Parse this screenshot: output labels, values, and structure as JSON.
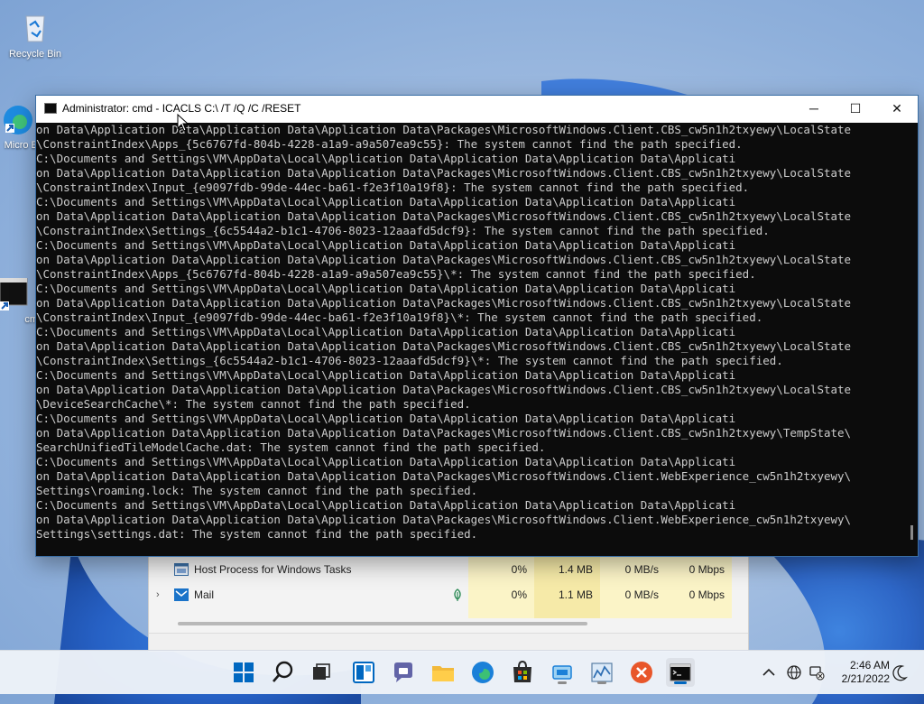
{
  "desktop": {
    "icons": [
      {
        "label": "Recycle Bin"
      },
      {
        "label": "Micro Ed"
      },
      {
        "label": "cm"
      }
    ]
  },
  "cmd_window": {
    "title": "Administrator: cmd - ICACLS  C:\\ /T /Q /C /RESET",
    "minimize_glyph": "─",
    "maximize_glyph": "☐",
    "close_glyph": "✕",
    "lines": [
      "on Data\\Application Data\\Application Data\\Application Data\\Packages\\MicrosoftWindows.Client.CBS_cw5n1h2txyewy\\LocalState",
      "\\ConstraintIndex\\Apps_{5c6767fd-804b-4228-a1a9-a9a507ea9c55}: The system cannot find the path specified.",
      "C:\\Documents and Settings\\VM\\AppData\\Local\\Application Data\\Application Data\\Application Data\\Applicati",
      "on Data\\Application Data\\Application Data\\Application Data\\Packages\\MicrosoftWindows.Client.CBS_cw5n1h2txyewy\\LocalState",
      "\\ConstraintIndex\\Input_{e9097fdb-99de-44ec-ba61-f2e3f10a19f8}: The system cannot find the path specified.",
      "C:\\Documents and Settings\\VM\\AppData\\Local\\Application Data\\Application Data\\Application Data\\Applicati",
      "on Data\\Application Data\\Application Data\\Application Data\\Packages\\MicrosoftWindows.Client.CBS_cw5n1h2txyewy\\LocalState",
      "\\ConstraintIndex\\Settings_{6c5544a2-b1c1-4706-8023-12aaafd5dcf9}: The system cannot find the path specified.",
      "C:\\Documents and Settings\\VM\\AppData\\Local\\Application Data\\Application Data\\Application Data\\Applicati",
      "on Data\\Application Data\\Application Data\\Application Data\\Packages\\MicrosoftWindows.Client.CBS_cw5n1h2txyewy\\LocalState",
      "\\ConstraintIndex\\Apps_{5c6767fd-804b-4228-a1a9-a9a507ea9c55}\\*: The system cannot find the path specified.",
      "C:\\Documents and Settings\\VM\\AppData\\Local\\Application Data\\Application Data\\Application Data\\Applicati",
      "on Data\\Application Data\\Application Data\\Application Data\\Packages\\MicrosoftWindows.Client.CBS_cw5n1h2txyewy\\LocalState",
      "\\ConstraintIndex\\Input_{e9097fdb-99de-44ec-ba61-f2e3f10a19f8}\\*: The system cannot find the path specified.",
      "C:\\Documents and Settings\\VM\\AppData\\Local\\Application Data\\Application Data\\Application Data\\Applicati",
      "on Data\\Application Data\\Application Data\\Application Data\\Packages\\MicrosoftWindows.Client.CBS_cw5n1h2txyewy\\LocalState",
      "\\ConstraintIndex\\Settings_{6c5544a2-b1c1-4706-8023-12aaafd5dcf9}\\*: The system cannot find the path specified.",
      "C:\\Documents and Settings\\VM\\AppData\\Local\\Application Data\\Application Data\\Application Data\\Applicati",
      "on Data\\Application Data\\Application Data\\Application Data\\Packages\\MicrosoftWindows.Client.CBS_cw5n1h2txyewy\\LocalState",
      "\\DeviceSearchCache\\*: The system cannot find the path specified.",
      "C:\\Documents and Settings\\VM\\AppData\\Local\\Application Data\\Application Data\\Application Data\\Applicati",
      "on Data\\Application Data\\Application Data\\Application Data\\Packages\\MicrosoftWindows.Client.CBS_cw5n1h2txyewy\\TempState\\",
      "SearchUnifiedTileModelCache.dat: The system cannot find the path specified.",
      "C:\\Documents and Settings\\VM\\AppData\\Local\\Application Data\\Application Data\\Application Data\\Applicati",
      "on Data\\Application Data\\Application Data\\Application Data\\Packages\\MicrosoftWindows.Client.WebExperience_cw5n1h2txyewy\\",
      "Settings\\roaming.lock: The system cannot find the path specified.",
      "C:\\Documents and Settings\\VM\\AppData\\Local\\Application Data\\Application Data\\Application Data\\Applicati",
      "on Data\\Application Data\\Application Data\\Application Data\\Packages\\MicrosoftWindows.Client.WebExperience_cw5n1h2txyewy\\",
      "Settings\\settings.dat: The system cannot find the path specified."
    ]
  },
  "task_manager": {
    "rows": [
      {
        "name": "Host Process for Windows Tasks",
        "cpu": "0%",
        "memory": "1.4 MB",
        "disk": "0 MB/s",
        "network": "0 Mbps",
        "expandable": false
      },
      {
        "name": "Mail",
        "cpu": "0%",
        "memory": "1.1 MB",
        "disk": "0 MB/s",
        "network": "0 Mbps",
        "expandable": true
      }
    ]
  },
  "taskbar": {
    "apps": [
      "start",
      "search",
      "task-view",
      "widgets",
      "teams-chat",
      "file-explorer",
      "edge",
      "store",
      "app-1",
      "task-manager",
      "app-x",
      "cmd"
    ],
    "clock": {
      "time": "2:46 AM",
      "date": "2/21/2022"
    },
    "colors": {
      "accent": "#0067c0",
      "taskbar_bg": "#eef2f8",
      "terminal_bg": "#0c0c0c",
      "terminal_fg": "#cccccc"
    }
  }
}
